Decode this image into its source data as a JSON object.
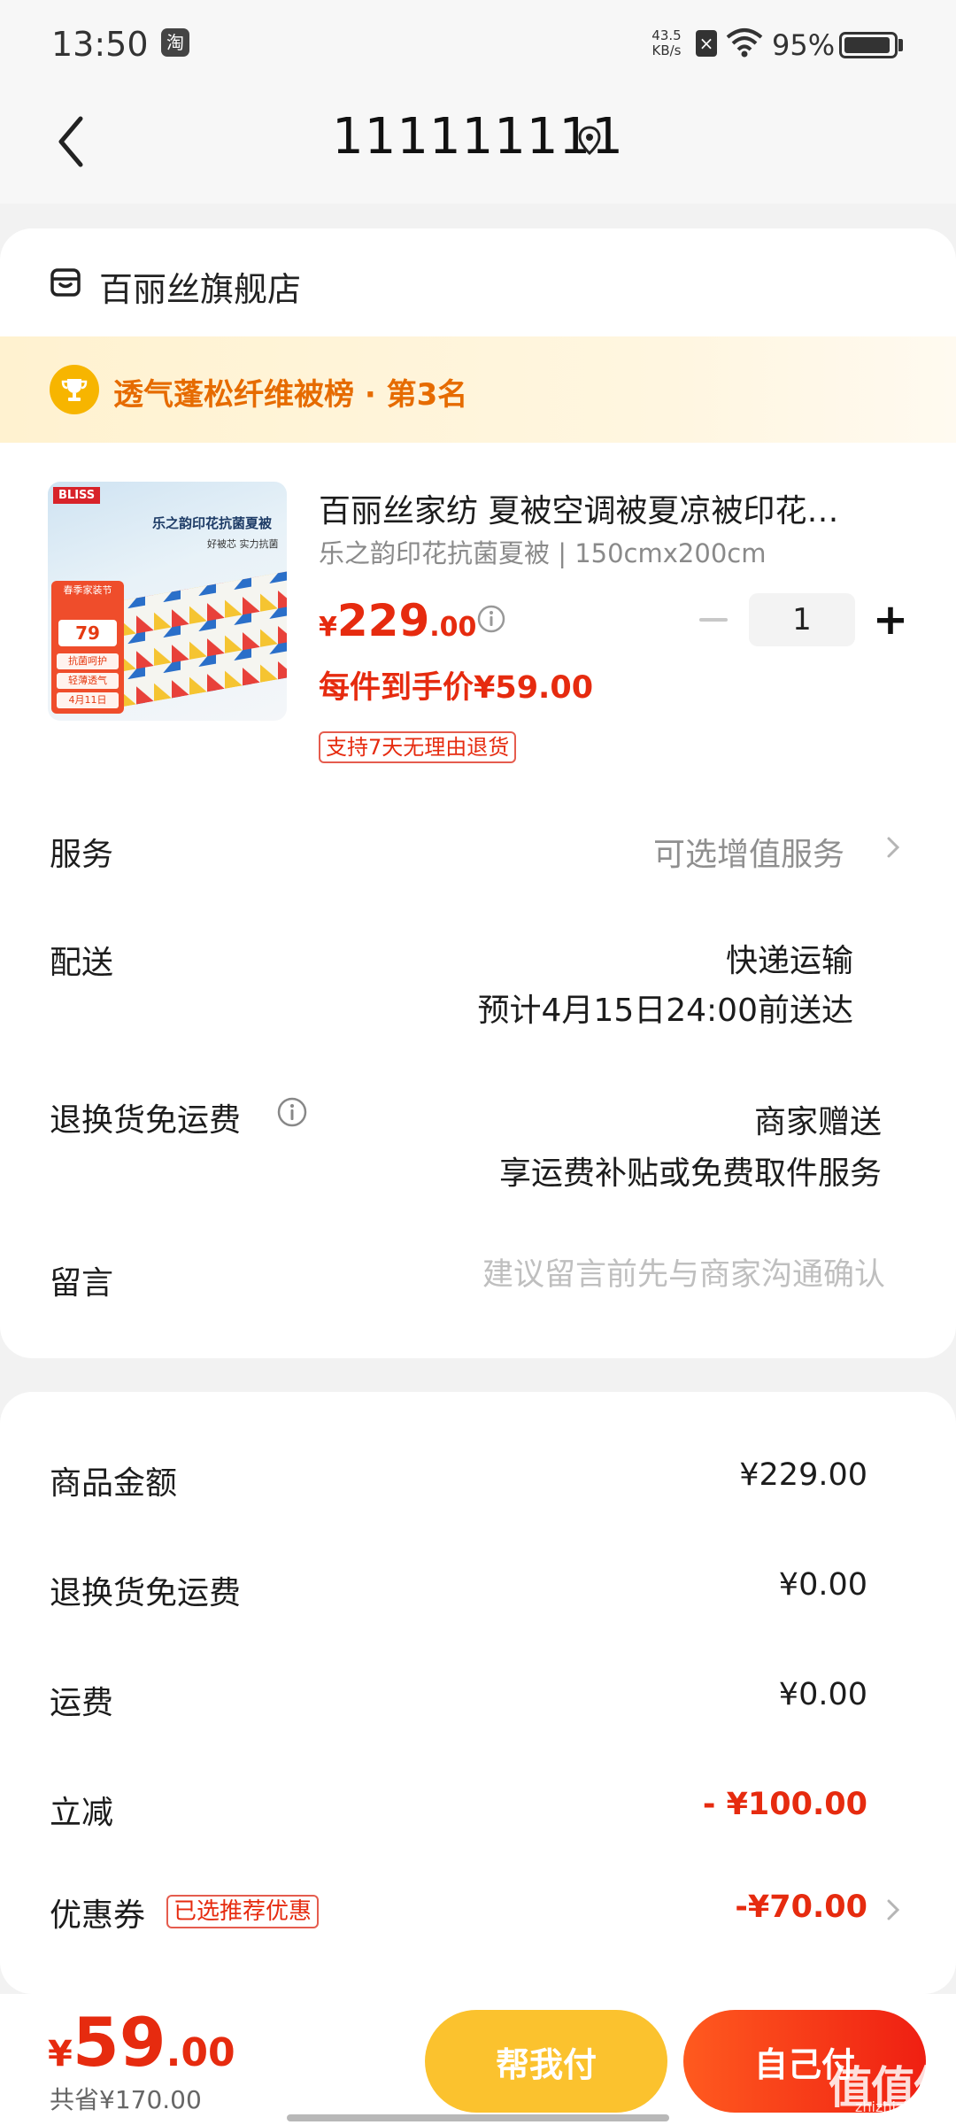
{
  "status_bar": {
    "time": "13:50",
    "app_icon_glyph": "淘",
    "net_speed_value": "43.5",
    "net_speed_unit": "KB/s",
    "battery": "95%",
    "battery_level": 0.95
  },
  "header": {
    "title": "111111111"
  },
  "shop": {
    "name": "百丽丝旗舰店"
  },
  "rank": {
    "text": "透气蓬松纤维被榜 · 第3名"
  },
  "product": {
    "image": {
      "brand": "BLISS",
      "tag": "",
      "title": "乐之韵印花抗菌夏被",
      "subtitle": "好被芯 实力抗菌",
      "badge_top": "春季家装节",
      "badge_price": "79",
      "chips": [
        "抗菌呵护",
        "轻薄透气",
        "4月11日"
      ]
    },
    "title": "百丽丝家纺 夏被空调被夏凉被印花…",
    "spec": "乐之韵印花抗菌夏被 | 150cmx200cm",
    "price_currency": "¥",
    "price_int": "229",
    "price_dec": ".00",
    "quantity": "1",
    "deal_price": "每件到手价¥59.00",
    "return_tag": "支持7天无理由退货"
  },
  "rows": {
    "service_label": "服务",
    "service_value": "可选增值服务",
    "delivery_label": "配送",
    "delivery_method": "快递运输",
    "delivery_eta": "预计4月15日24:00前送达",
    "return_fee_label": "退换货免运费",
    "return_fee_value": "商家赠送",
    "return_fee_desc": "享运费补贴或免费取件服务",
    "note_label": "留言",
    "note_placeholder": "建议留言前先与商家沟通确认"
  },
  "summary": {
    "goods_label": "商品金额",
    "goods_value": "¥229.00",
    "return_fee_label": "退换货免运费",
    "return_fee_value": "¥0.00",
    "shipping_label": "运费",
    "shipping_value": "¥0.00",
    "discount_label": "立减",
    "discount_value": "- ¥100.00",
    "coupon_label": "优惠券",
    "coupon_tag": "已选推荐优惠",
    "coupon_value": "-¥70.00"
  },
  "bottom": {
    "total_currency": "¥",
    "total_int": "59",
    "total_dec": ".00",
    "saved": "共省¥170.00",
    "help_pay_label": "帮我付",
    "self_pay_label": "自己付",
    "watermark": "值值值",
    "watermark_sub": "zhizhizhi.com"
  },
  "colors": {
    "accent_red": "#e62b0f",
    "rank_orange": "#e66b00",
    "help_button": "#fbc22e",
    "self_button": "#ef1f12"
  },
  "icons": [
    "back-arrow-icon",
    "location-pin-icon",
    "shop-icon",
    "trophy-icon",
    "info-icon",
    "chevron-right-icon",
    "wifi-icon",
    "battery-icon"
  ]
}
